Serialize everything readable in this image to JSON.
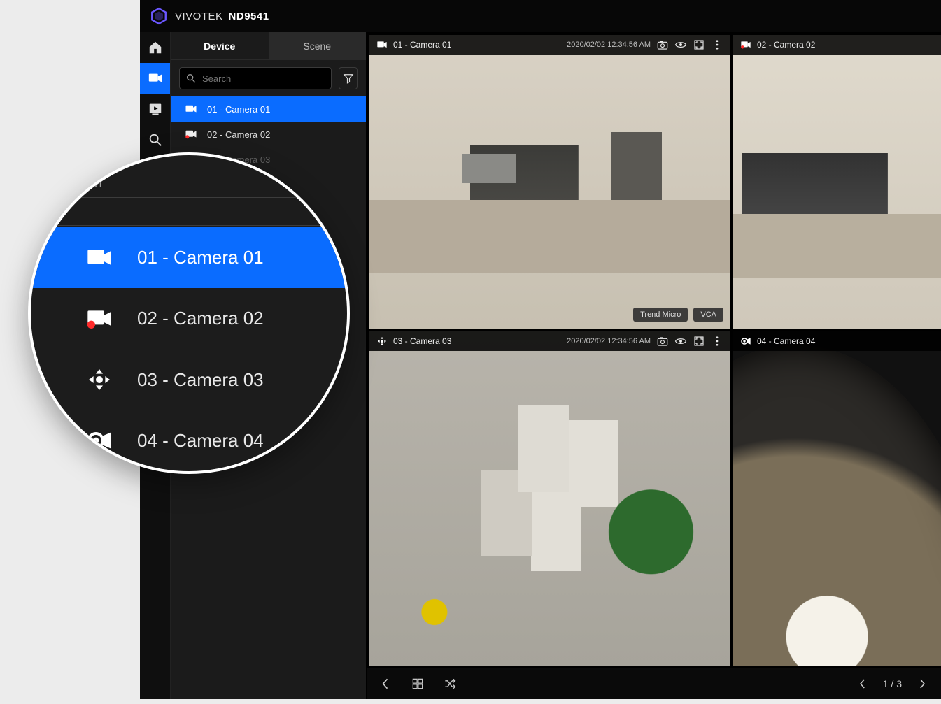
{
  "header": {
    "brand": "VIVOTEK",
    "model": "ND9541"
  },
  "rail_icons": {
    "home": "home",
    "live": "live",
    "playback": "playback",
    "search": "search"
  },
  "sidebar": {
    "tabs": {
      "device": "Device",
      "scene": "Scene"
    },
    "search_placeholder": "Search",
    "items": [
      {
        "label": "01 - Camera 01"
      },
      {
        "label": "02 - Camera 02"
      },
      {
        "label": "03 - Camera 03"
      }
    ]
  },
  "tiles": [
    {
      "title": "01 - Camera 01",
      "timestamp": "2020/02/02  12:34:56  AM",
      "badges": [
        "Trend Micro",
        "VCA"
      ]
    },
    {
      "title": "02 - Camera 02"
    },
    {
      "title": "03 - Camera 03",
      "timestamp": "2020/02/02  12:34:56  AM"
    },
    {
      "title": "04 - Camera 04"
    }
  ],
  "footer": {
    "page_label": "1 / 3"
  },
  "magnifier": {
    "hint": "arch",
    "items": [
      {
        "label": "01 - Camera 01"
      },
      {
        "label": "02 - Camera 02"
      },
      {
        "label": "03 - Camera 03"
      },
      {
        "label": "04 - Camera 04"
      }
    ]
  },
  "colors": {
    "accent": "#0a6cff",
    "bg_dark": "#1b1b1b"
  }
}
